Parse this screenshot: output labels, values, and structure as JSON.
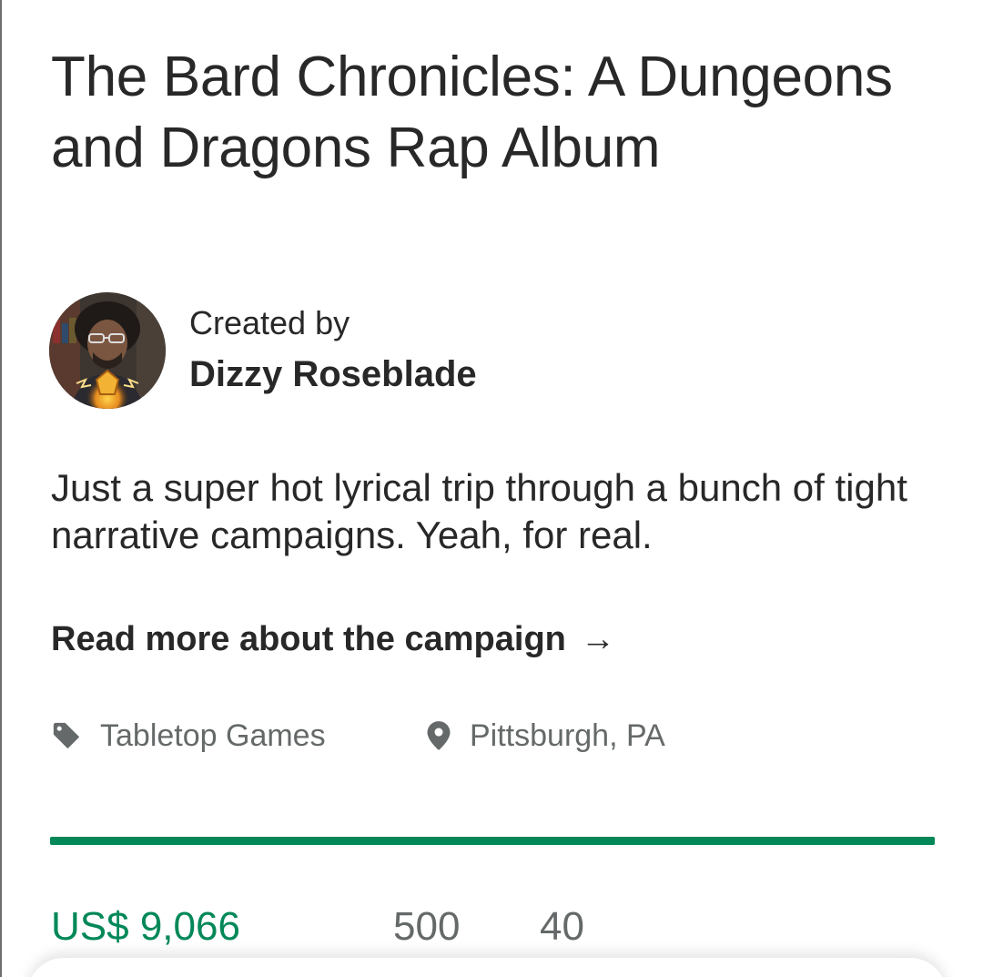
{
  "project": {
    "title": "The Bard Chronicles: A Dungeons and Dragons Rap Album",
    "blurb": "Just a super hot lyrical trip through a bunch of tight narrative campaigns. Yeah, for real.",
    "read_more_label": "Read more about the campaign",
    "read_more_arrow": "→"
  },
  "creator": {
    "label": "Created by",
    "name": "Dizzy Roseblade",
    "avatar_icon": "creator-avatar"
  },
  "meta": {
    "category": {
      "icon": "tag-icon",
      "label": "Tabletop Games"
    },
    "location": {
      "icon": "location-pin-icon",
      "label": "Pittsburgh, PA"
    }
  },
  "funding": {
    "progress_fraction": 1.0,
    "pledged": "US$ 9,066",
    "backers": "500",
    "days": "40"
  },
  "colors": {
    "accent_green": "#028858",
    "text_primary": "#282828",
    "text_secondary": "#656969"
  }
}
